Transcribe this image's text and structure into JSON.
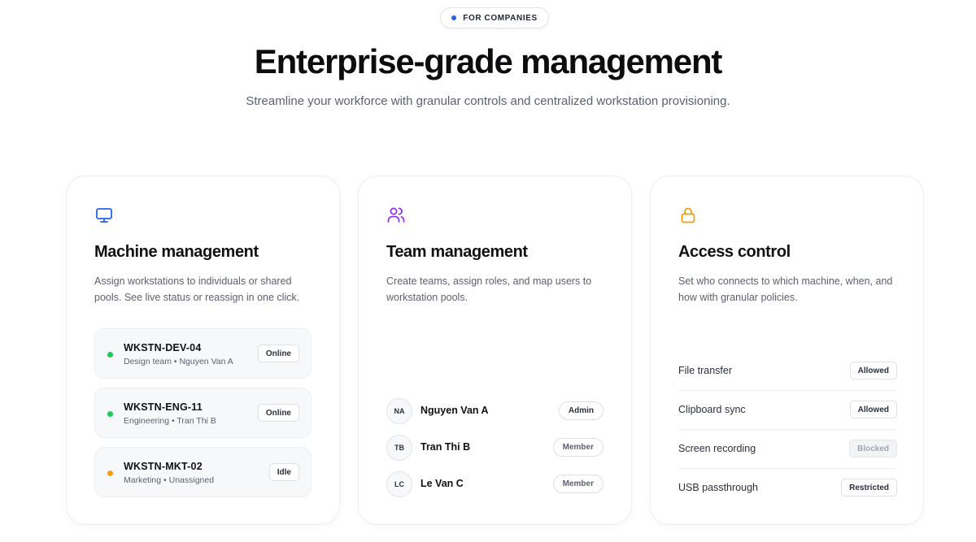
{
  "header": {
    "badge_label": "FOR COMPANIES",
    "title": "Enterprise-grade management",
    "subtitle": "Streamline your workforce with granular controls and centralized workstation provisioning."
  },
  "colors": {
    "badge_dot": "#2563eb",
    "machine_icon": "#2563eb",
    "team_icon": "#9333ea",
    "access_icon": "#f59e0b",
    "status_online": "#22c55e",
    "status_idle": "#f59e0b"
  },
  "cards": {
    "machine": {
      "icon": "monitor-icon",
      "title": "Machine management",
      "description": "Assign workstations to individuals or shared pools. See live status or reassign in one click.",
      "machines": [
        {
          "name": "WKSTN-DEV-04",
          "meta": "Design team • Nguyen Van A",
          "status": "Online",
          "status_color": "#22c55e"
        },
        {
          "name": "WKSTN-ENG-11",
          "meta": "Engineering • Tran Thi B",
          "status": "Online",
          "status_color": "#22c55e"
        },
        {
          "name": "WKSTN-MKT-02",
          "meta": "Marketing • Unassigned",
          "status": "Idle",
          "status_color": "#f59e0b"
        }
      ]
    },
    "team": {
      "icon": "users-icon",
      "title": "Team management",
      "description": "Create teams, assign roles, and map users to workstation pools.",
      "members": [
        {
          "initials": "NA",
          "name": "Nguyen Van A",
          "role": "Admin"
        },
        {
          "initials": "TB",
          "name": "Tran Thi B",
          "role": "Member"
        },
        {
          "initials": "LC",
          "name": "Le Van C",
          "role": "Member"
        }
      ]
    },
    "access": {
      "icon": "lock-icon",
      "title": "Access control",
      "description": "Set who connects to which machine, when, and how with granular policies.",
      "policies": [
        {
          "name": "File transfer",
          "value": "Allowed"
        },
        {
          "name": "Clipboard sync",
          "value": "Allowed"
        },
        {
          "name": "Screen recording",
          "value": "Blocked"
        },
        {
          "name": "USB passthrough",
          "value": "Restricted"
        }
      ]
    }
  }
}
